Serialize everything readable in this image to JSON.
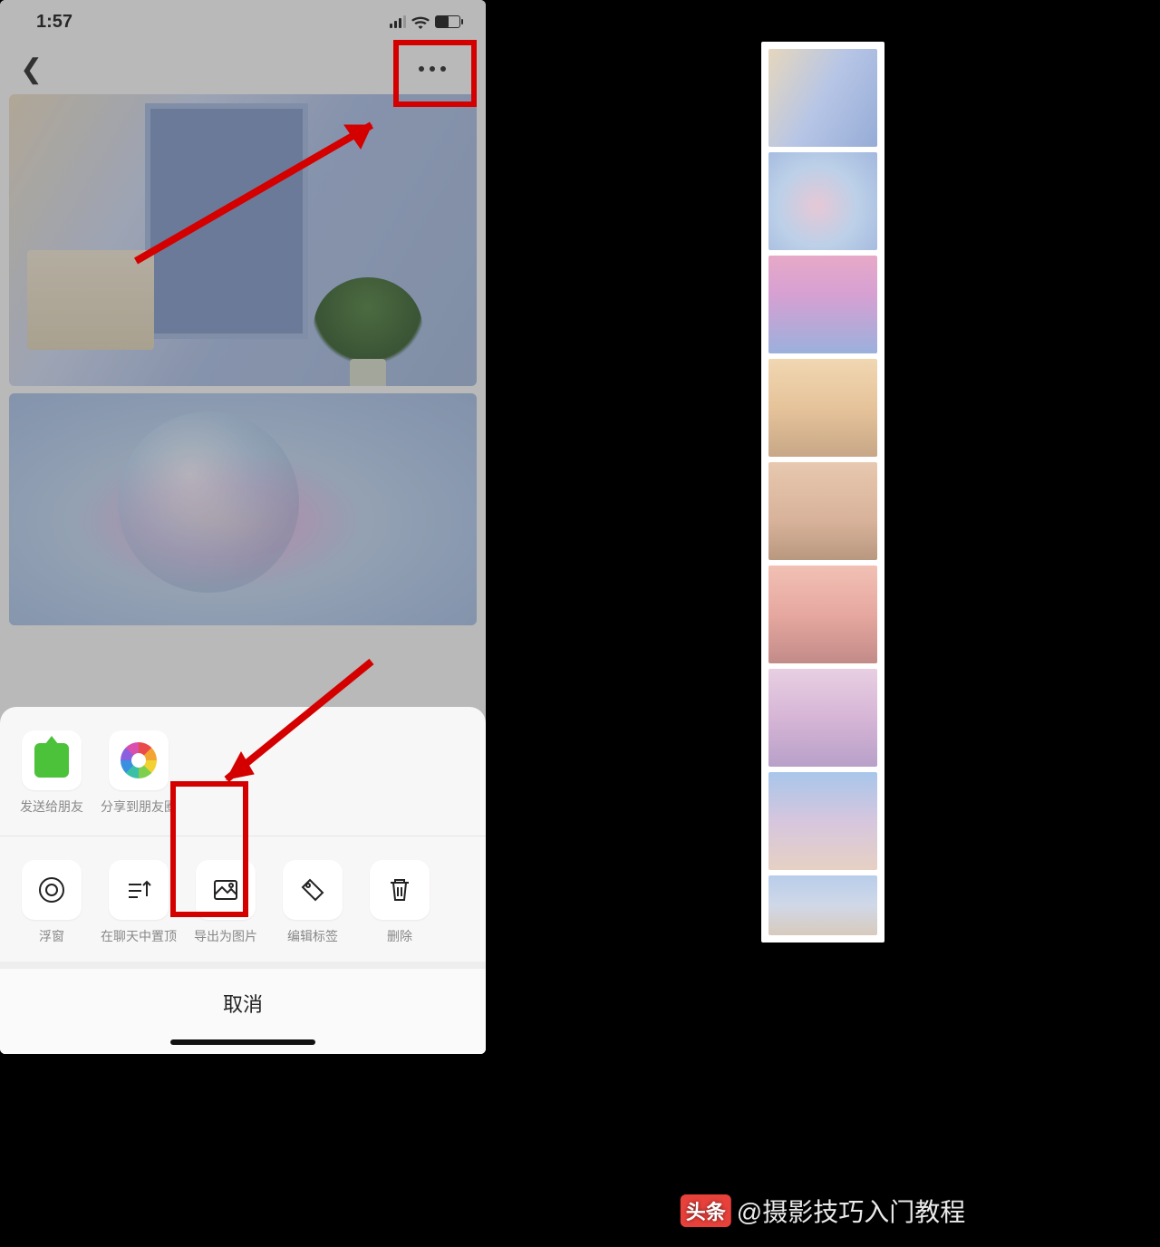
{
  "status": {
    "time": "1:57"
  },
  "share_sheet": {
    "share_items": [
      {
        "label": "发送给朋友",
        "icon": "wechat-send-icon"
      },
      {
        "label": "分享到朋友圈",
        "icon": "moments-icon"
      }
    ],
    "action_items": [
      {
        "label": "浮窗",
        "icon": "float-window-icon"
      },
      {
        "label": "在聊天中置顶",
        "icon": "pin-chat-icon"
      },
      {
        "label": "导出为图片",
        "icon": "export-image-icon"
      },
      {
        "label": "编辑标签",
        "icon": "edit-tag-icon"
      },
      {
        "label": "删除",
        "icon": "trash-icon"
      }
    ],
    "cancel_label": "取消"
  },
  "watermark": {
    "badge": "头条",
    "text": "@摄影技巧入门教程"
  }
}
